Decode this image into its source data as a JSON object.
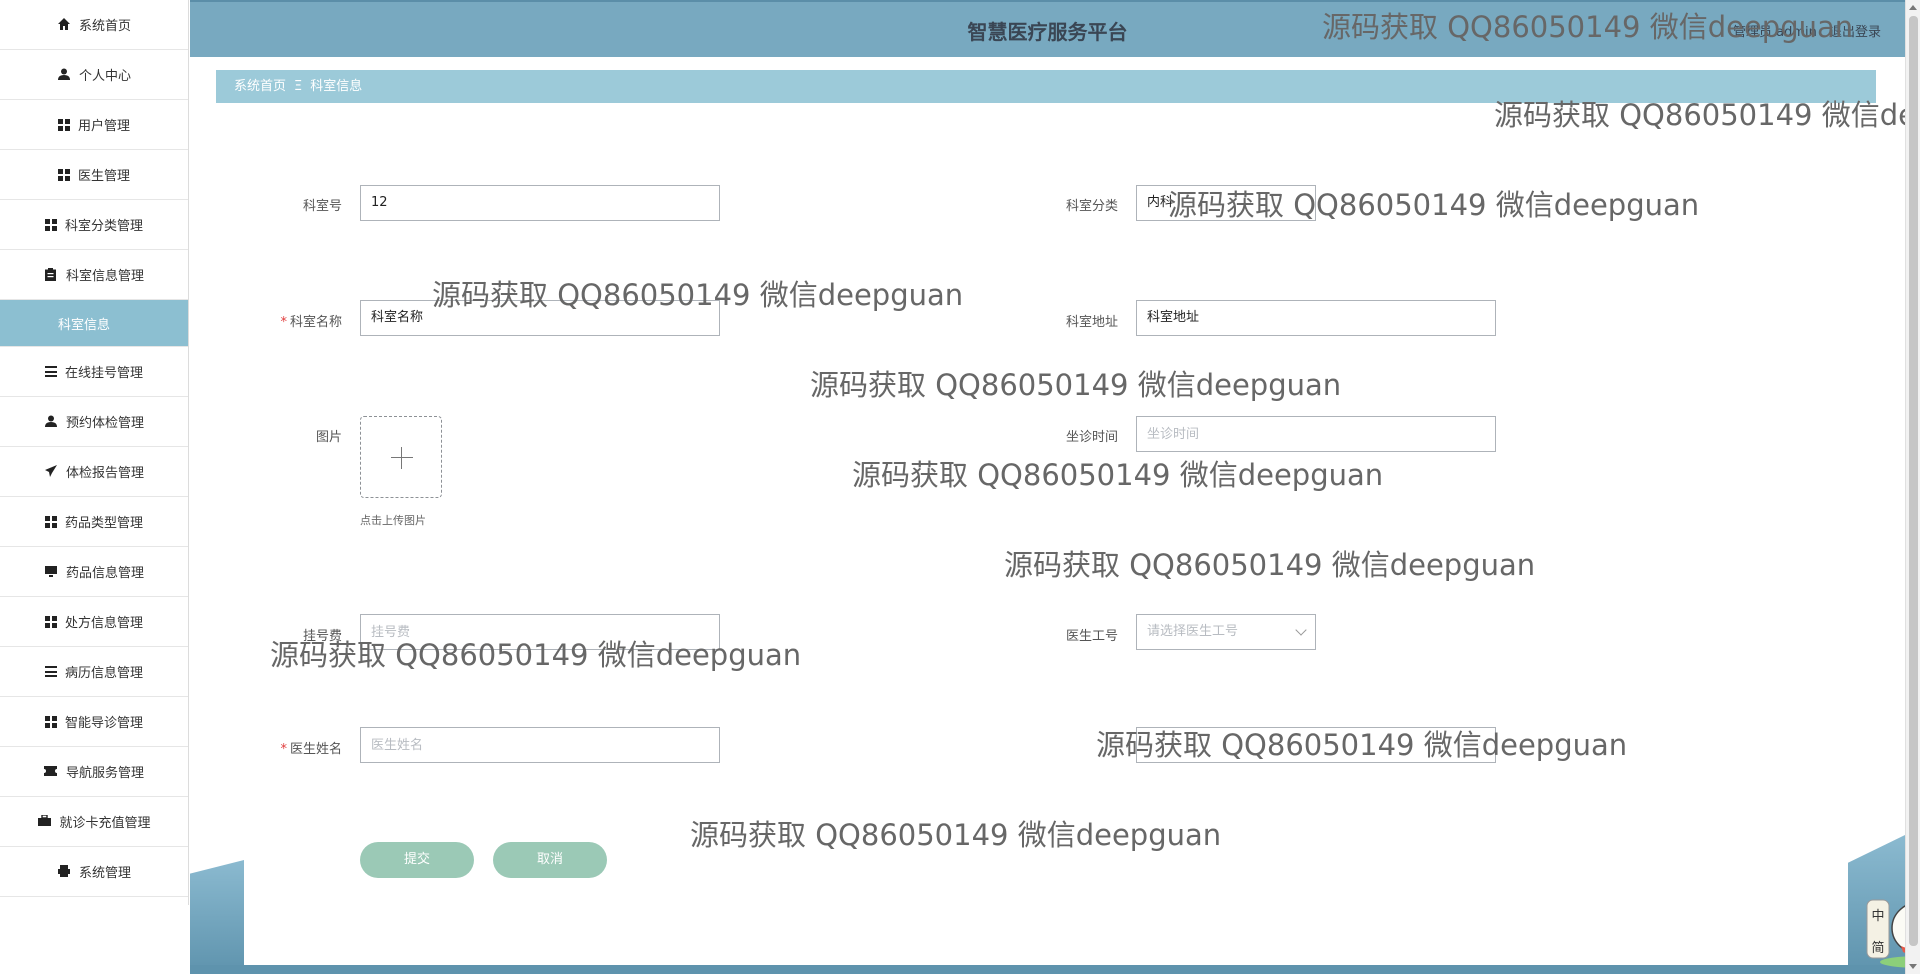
{
  "sidebar": {
    "items": [
      {
        "label": "系统首页",
        "icon": "home-icon"
      },
      {
        "label": "个人中心",
        "icon": "user-icon"
      },
      {
        "label": "用户管理",
        "icon": "grid-icon"
      },
      {
        "label": "医生管理",
        "icon": "grid-icon"
      },
      {
        "label": "科室分类管理",
        "icon": "grid-icon"
      },
      {
        "label": "科室信息管理",
        "icon": "clipboard-icon"
      },
      {
        "label": "科室信息",
        "icon": ""
      },
      {
        "label": "在线挂号管理",
        "icon": "list-icon"
      },
      {
        "label": "预约体检管理",
        "icon": "user-icon"
      },
      {
        "label": "体检报告管理",
        "icon": "send-icon"
      },
      {
        "label": "药品类型管理",
        "icon": "grid-icon"
      },
      {
        "label": "药品信息管理",
        "icon": "monitor-icon"
      },
      {
        "label": "处方信息管理",
        "icon": "grid-icon"
      },
      {
        "label": "病历信息管理",
        "icon": "list-icon"
      },
      {
        "label": "智能导诊管理",
        "icon": "grid-icon"
      },
      {
        "label": "导航服务管理",
        "icon": "ticket-icon"
      },
      {
        "label": "就诊卡充值管理",
        "icon": "briefcase-icon"
      },
      {
        "label": "系统管理",
        "icon": "printer-icon"
      }
    ]
  },
  "header": {
    "title": "智慧医疗服务平台",
    "user_info": "管理员 admin",
    "logout": "退出登录"
  },
  "breadcrumb": {
    "home": "系统首页",
    "separator": "Ξ",
    "current": "科室信息"
  },
  "form": {
    "dept_no": {
      "label": "科室号",
      "value": "12"
    },
    "dept_category": {
      "label": "科室分类",
      "value": "内科"
    },
    "dept_name": {
      "label": "科室名称",
      "value": "科室名称"
    },
    "dept_address": {
      "label": "科室地址",
      "value": "科室地址"
    },
    "image": {
      "label": "图片",
      "hint": "点击上传图片"
    },
    "clinic_time": {
      "label": "坐诊时间",
      "placeholder": "坐诊时间"
    },
    "reg_fee": {
      "label": "挂号费",
      "placeholder": "挂号费"
    },
    "doctor_id": {
      "label": "医生工号",
      "placeholder": "请选择医生工号"
    },
    "doctor_name": {
      "label": "医生姓名",
      "placeholder": "医生姓名"
    },
    "submit": "提交",
    "cancel": "取消"
  },
  "watermark": {
    "text": "源码获取 QQ86050149 微信deepguan",
    "text_clipped": "源码获取 QQ86050149 微信de"
  },
  "mascot": {
    "glyph_1": "中",
    "glyph_2": "简"
  },
  "colors": {
    "header": "#78a9c0",
    "breadcrumb": "#9ccad9",
    "active_sub": "#8cbfd1",
    "button": "#9bc9b6"
  }
}
